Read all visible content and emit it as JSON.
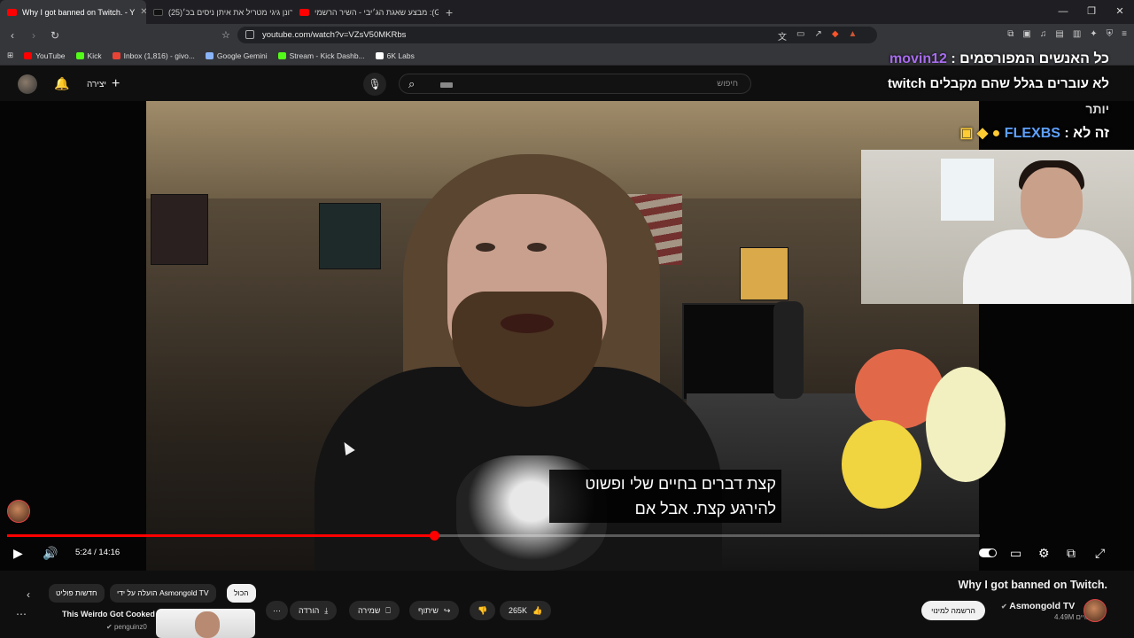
{
  "browser": {
    "tabs": [
      {
        "title": "Why I got banned on Twitch. - Y",
        "active": true
      },
      {
        "title": "(25)רונן גיגי מטריל את איתן ניסים בכ׳",
        "active": false
      },
      {
        "title": "מבצע שאגת הג׳יבי - השיר הרשמי :(G",
        "active": false
      }
    ],
    "new_tab": "+",
    "url": "youtube.com/watch?v=VZsV50MKRbs",
    "bookmarks": [
      {
        "label": "YouTube",
        "color": "#ff0000"
      },
      {
        "label": "Kick",
        "color": "#53fc18"
      },
      {
        "label": "Inbox (1,816) - givo...",
        "color": "#ea4335"
      },
      {
        "label": "Google Gemini",
        "color": "#8ab4f8"
      },
      {
        "label": "Stream - Kick Dashb...",
        "color": "#53fc18"
      },
      {
        "label": "6K Labs",
        "color": "#ffffff"
      }
    ]
  },
  "youtube": {
    "create_label": "יצירה",
    "search_placeholder": "חיפוש",
    "overlay": {
      "chat_line1_name": "movin12",
      "chat_line1_text": "כל האנשים המפורסמים :",
      "chat_line2_text": "לא עוברים בגלל שהם מקבלים twitch",
      "chat_line3_text": "יותר",
      "chat_line4_name": "FLEXBS",
      "chat_line4_text": "זה לא :"
    },
    "subtitles": {
      "line1": "קצת דברים בחיים שלי ופשוט",
      "line2": "להירגע קצת.  אבל אם"
    },
    "player": {
      "time": "5:24 / 14:16",
      "progress": 0.439
    },
    "video": {
      "title": "Why I got banned on Twitch.",
      "channel": "Asmongold TV",
      "subscribers": "4.49M מנויים",
      "subscribe_label": "הרשמה למינוי",
      "likes": "265K",
      "share_label": "שיתוף",
      "save_label": "שמירה",
      "download_label": "הורדה"
    },
    "chips": [
      "הכול",
      "הועלה על ידי Asmongold TV",
      "חדשות פוליט"
    ],
    "recommended": {
      "title": "This Weirdo Got Cooked",
      "channel": "penguinz0"
    }
  }
}
